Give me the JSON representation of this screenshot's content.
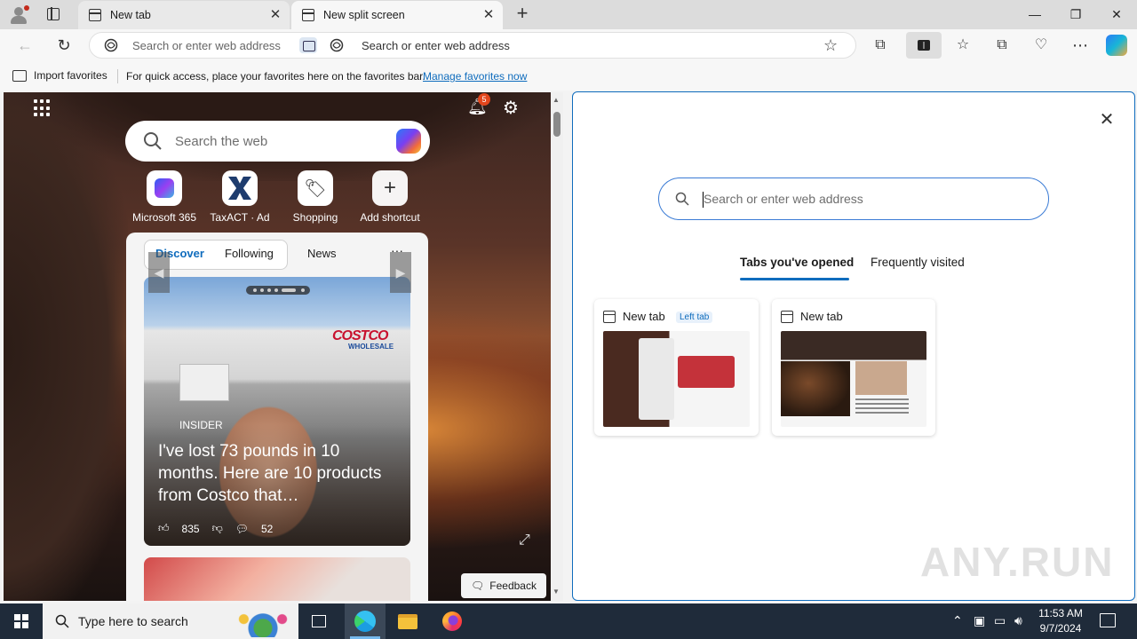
{
  "browser": {
    "tabs": [
      {
        "title": "New tab"
      },
      {
        "title": "New split screen"
      }
    ],
    "address_left": "Search or enter web address",
    "address_right": "Search or enter web address",
    "favorites_bar": {
      "import_label": "Import favorites",
      "message": "For quick access, place your favorites here on the favorites bar.",
      "link": "Manage favorites now"
    }
  },
  "left_page": {
    "search_placeholder": "Search the web",
    "notification_count": "5",
    "shortcuts": [
      {
        "label": "Microsoft 365"
      },
      {
        "label": "TaxACT · Ad"
      },
      {
        "label": "Shopping"
      },
      {
        "label": "Add shortcut"
      }
    ],
    "feed_tabs": {
      "discover": "Discover",
      "following": "Following",
      "news": "News",
      "more": "···"
    },
    "story": {
      "logo": "COSTCO",
      "logo_sub": "WHOLESALE",
      "source": "INSIDER",
      "headline": "I've lost 73 pounds in 10 months. Here are 10 products from Costco that…",
      "likes": "835",
      "comments": "52"
    },
    "feedback": "Feedback"
  },
  "right_page": {
    "search_placeholder": "Search or enter web address",
    "tabs": {
      "opened": "Tabs you've opened",
      "frequent": "Frequently visited"
    },
    "cards": [
      {
        "title": "New tab",
        "badge": "Left tab"
      },
      {
        "title": "New tab"
      }
    ]
  },
  "watermark": "ANY.RUN",
  "taskbar": {
    "search_placeholder": "Type here to search",
    "time": "11:53 AM",
    "date": "9/7/2024"
  },
  "colors": {
    "accent": "#0f6cbd",
    "taskbar": "#1f2b3a"
  }
}
